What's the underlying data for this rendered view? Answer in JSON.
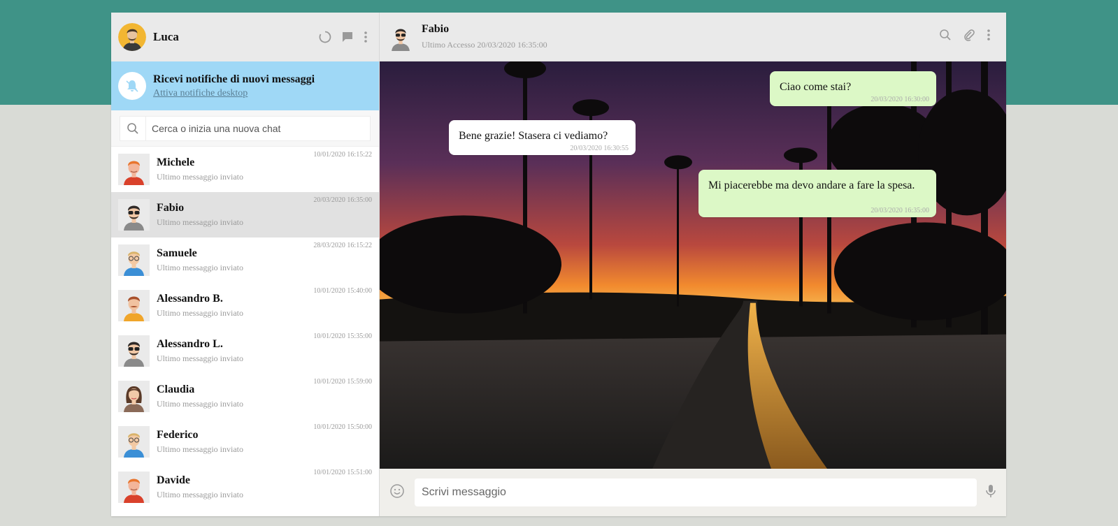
{
  "user": {
    "name": "Luca"
  },
  "notification": {
    "title": "Ricevi notifiche di nuovi messaggi",
    "link": "Attiva notifiche desktop"
  },
  "search": {
    "placeholder": "Cerca o inizia una nuova chat"
  },
  "contacts": [
    {
      "name": "Michele",
      "last": "Ultimo messaggio inviato",
      "time": "10/01/2020 16:15:22"
    },
    {
      "name": "Fabio",
      "last": "Ultimo messaggio inviato",
      "time": "20/03/2020 16:35:00"
    },
    {
      "name": "Samuele",
      "last": "Ultimo messaggio inviato",
      "time": "28/03/2020 16:15:22"
    },
    {
      "name": "Alessandro B.",
      "last": "Ultimo messaggio inviato",
      "time": "10/01/2020 15:40:00"
    },
    {
      "name": "Alessandro L.",
      "last": "Ultimo messaggio inviato",
      "time": "10/01/2020 15:35:00"
    },
    {
      "name": "Claudia",
      "last": "Ultimo messaggio inviato",
      "time": "10/01/2020 15:59:00"
    },
    {
      "name": "Federico",
      "last": "Ultimo messaggio inviato",
      "time": "10/01/2020 15:50:00"
    },
    {
      "name": "Davide",
      "last": "Ultimo messaggio inviato",
      "time": "10/01/2020 15:51:00"
    }
  ],
  "active_chat": {
    "name": "Fabio",
    "last_seen": "Ultimo Accesso 20/03/2020 16:35:00"
  },
  "messages": [
    {
      "text": "Ciao come stai?",
      "time": "20/03/2020 16:30:00",
      "type": "sent"
    },
    {
      "text": "Bene grazie! Stasera ci vediamo?",
      "time": "20/03/2020 16:30:55",
      "type": "received"
    },
    {
      "text": "Mi piacerebbe ma devo andare a fare la spesa.",
      "time": "20/03/2020 16:35:00",
      "type": "sent"
    }
  ],
  "composer": {
    "placeholder": "Scrivi messaggio"
  },
  "icons": {
    "status": "status-circle-icon",
    "new_chat": "chat-bubble-icon",
    "menu": "vertical-dots-icon",
    "bell_off": "bell-off-icon",
    "search": "search-icon",
    "attach": "paperclip-icon",
    "emoji": "smiley-icon",
    "mic": "microphone-icon"
  },
  "colors": {
    "header_band": "#3f9387",
    "sent_bubble": "#dcf8c6",
    "notification_bg": "#9fd8f6",
    "active_row": "#e1e1e1"
  }
}
